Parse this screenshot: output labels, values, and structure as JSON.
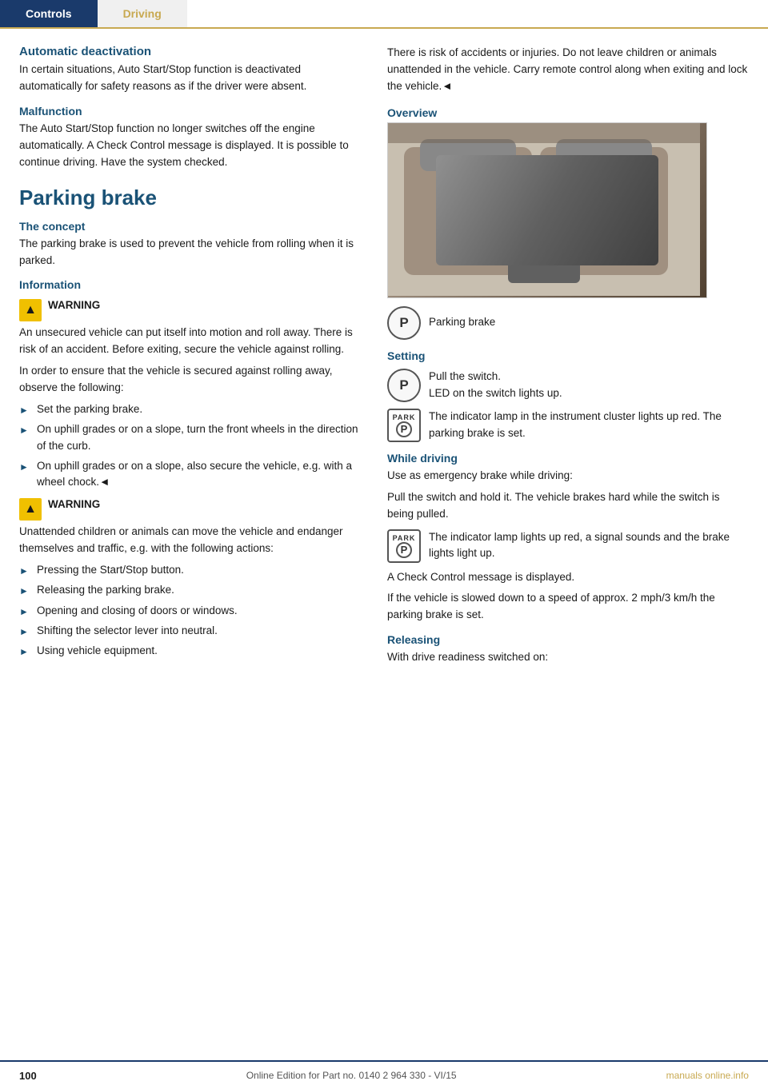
{
  "nav": {
    "tab1": {
      "label": "Controls",
      "active": true
    },
    "tab2": {
      "label": "Driving",
      "active": false
    }
  },
  "left": {
    "auto_deactivation": {
      "heading": "Automatic deactivation",
      "body": "In certain situations, Auto Start/Stop function is deactivated automatically for safety reasons as if the driver were absent."
    },
    "malfunction": {
      "heading": "Malfunction",
      "body": "The Auto Start/Stop function no longer switches off the engine automatically. A Check Control message is displayed. It is possible to continue driving. Have the system checked."
    },
    "parking_brake": {
      "heading": "Parking brake"
    },
    "the_concept": {
      "heading": "The concept",
      "body": "The parking brake is used to prevent the vehicle from rolling when it is parked."
    },
    "information": {
      "heading": "Information"
    },
    "warning1": {
      "label": "WARNING",
      "body": "An unsecured vehicle can put itself into motion and roll away. There is risk of an accident. Before exiting, secure the vehicle against rolling."
    },
    "in_order_text": "In order to ensure that the vehicle is secured against rolling away, observe the following:",
    "bullets1": [
      "Set the parking brake.",
      "On uphill grades or on a slope, turn the front wheels in the direction of the curb.",
      "On uphill grades or on a slope, also secure the vehicle, e.g. with a wheel chock.◄"
    ],
    "warning2": {
      "label": "WARNING",
      "body": "Unattended children or animals can move the vehicle and endanger themselves and traffic, e.g. with the following actions:"
    },
    "bullets2": [
      "Pressing the Start/Stop button.",
      "Releasing the parking brake.",
      "Opening and closing of doors or windows.",
      "Shifting the selector lever into neutral.",
      "Using vehicle equipment."
    ]
  },
  "right": {
    "intro_text": "There is risk of accidents or injuries. Do not leave children or animals unattended in the vehicle. Carry remote control along when exiting and lock the vehicle.◄",
    "overview": {
      "heading": "Overview",
      "image_alt": "Car interior overview showing controls"
    },
    "parking_brake_icon_label": "Parking brake",
    "setting": {
      "heading": "Setting",
      "step1": "Pull the switch.",
      "step2": "LED on the switch lights up.",
      "info": "The indicator lamp in the instrument cluster lights up red. The parking brake is set."
    },
    "while_driving": {
      "heading": "While driving",
      "body1": "Use as emergency brake while driving:",
      "body2": "Pull the switch and hold it. The vehicle brakes hard while the switch is being pulled.",
      "info": "The indicator lamp lights up red, a signal sounds and the brake lights light up.",
      "body3": "A Check Control message is displayed.",
      "body4": "If the vehicle is slowed down to a speed of approx. 2 mph/3 km/h the parking brake is set."
    },
    "releasing": {
      "heading": "Releasing",
      "body": "With drive readiness switched on:"
    }
  },
  "footer": {
    "page": "100",
    "info": "Online Edition for Part no. 0140 2 964 330 - VI/15",
    "logo": "manuals online.info"
  }
}
